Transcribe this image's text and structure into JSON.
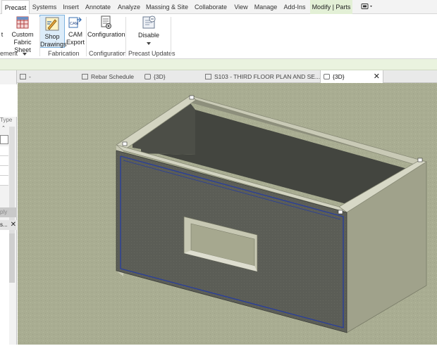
{
  "menu": {
    "tabs": [
      {
        "label": "Precast",
        "state": "active"
      },
      {
        "label": "Systems",
        "state": "normal"
      },
      {
        "label": "Insert",
        "state": "normal"
      },
      {
        "label": "Annotate",
        "state": "normal"
      },
      {
        "label": "Analyze",
        "state": "normal"
      },
      {
        "label": "Massing & Site",
        "state": "normal"
      },
      {
        "label": "Collaborate",
        "state": "normal"
      },
      {
        "label": "View",
        "state": "normal"
      },
      {
        "label": "Manage",
        "state": "normal"
      },
      {
        "label": "Add-Ins",
        "state": "normal"
      },
      {
        "label": "Modify | Parts",
        "state": "contextual"
      }
    ]
  },
  "ribbon": {
    "partial_left": "t",
    "custom_fabric_line1": "Custom",
    "custom_fabric_line2": "Fabric Sheet",
    "shop_drawings_line1": "Shop",
    "shop_drawings_line2": "Drawings",
    "cam_export_line1": "CAM",
    "cam_export_line2": "Export",
    "cam_icon_text": "CAM",
    "configuration_label": "Configuration",
    "disable_label": "Disable",
    "panel_element_partial": "ement",
    "panel_fabrication": "Fabrication",
    "panel_configuration": "Configuration",
    "panel_precast_updates": "Precast Updates"
  },
  "view_tabs": [
    {
      "label": "-",
      "active": false
    },
    {
      "label": "Rebar Schedule",
      "active": false
    },
    {
      "label": "{3D}",
      "active": false
    },
    {
      "label": "S103 - THIRD FLOOR PLAN AND SE...",
      "active": false
    },
    {
      "label": "{3D}",
      "active": true
    }
  ],
  "left_panel": {
    "type_partial": "Type",
    "apply_partial": "ply",
    "browser_partial": "s..."
  },
  "colors": {
    "viewport_background": "#a9ad92",
    "panel_front": "#5b5d56",
    "panel_side": "#a0a28b",
    "panel_top": "#d3d4c1",
    "selection_outline": "#2a3f9a"
  }
}
